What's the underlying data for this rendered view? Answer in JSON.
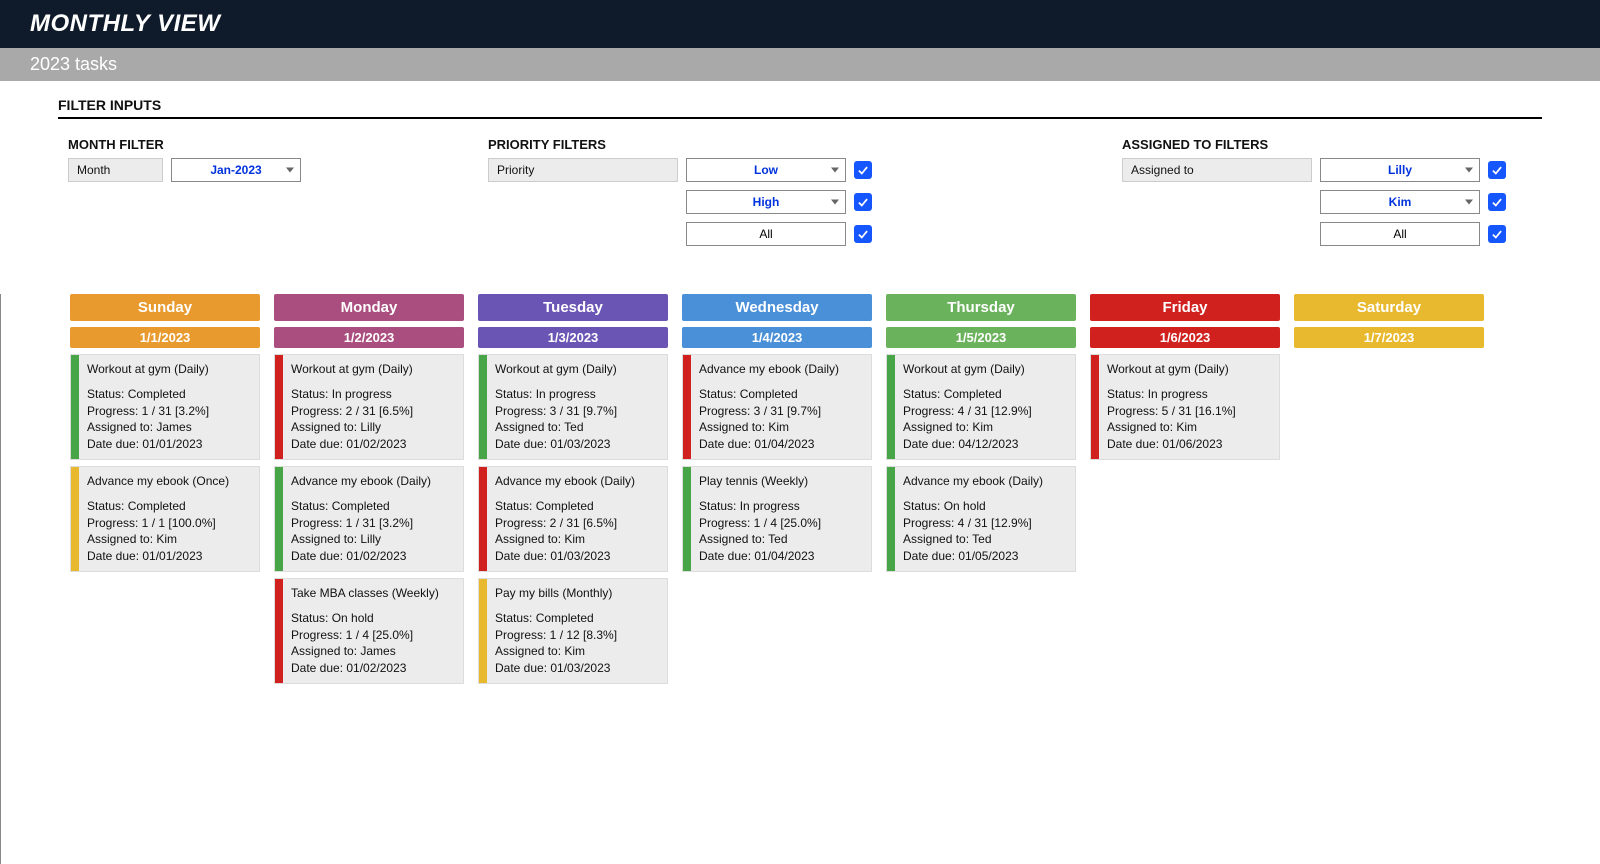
{
  "header": {
    "title": "MONTHLY VIEW",
    "subtitle": "2023 tasks"
  },
  "sections": {
    "filterInputs": "FILTER INPUTS"
  },
  "filters": {
    "month": {
      "heading": "MONTH FILTER",
      "label": "Month",
      "value": "Jan-2023"
    },
    "priority": {
      "heading": "PRIORITY FILTERS",
      "label": "Priority",
      "rows": [
        {
          "value": "Low",
          "checked": true,
          "plain": false
        },
        {
          "value": "High",
          "checked": true,
          "plain": false
        },
        {
          "value": "All",
          "checked": true,
          "plain": true
        }
      ]
    },
    "assigned": {
      "heading": "ASSIGNED TO FILTERS",
      "label": "Assigned to",
      "rows": [
        {
          "value": "Lilly",
          "checked": true,
          "plain": false
        },
        {
          "value": "Kim",
          "checked": true,
          "plain": false
        },
        {
          "value": "All",
          "checked": true,
          "plain": true
        }
      ]
    }
  },
  "calendar": {
    "days": [
      {
        "name": "Sunday",
        "date": "1/1/2023",
        "color": "c-sun",
        "tasks": [
          {
            "bar": "b-green",
            "title": "Workout at gym (Daily)",
            "status": "Completed",
            "progress": "1 / 31  [3.2%]",
            "assigned": "James",
            "due": "01/01/2023"
          },
          {
            "bar": "b-yellow",
            "title": "Advance my ebook (Once)",
            "status": "Completed",
            "progress": "1 / 1  [100.0%]",
            "assigned": "Kim",
            "due": "01/01/2023"
          }
        ]
      },
      {
        "name": "Monday",
        "date": "1/2/2023",
        "color": "c-mon",
        "tasks": [
          {
            "bar": "b-red",
            "title": "Workout at gym (Daily)",
            "status": "In progress",
            "progress": "2 / 31  [6.5%]",
            "assigned": "Lilly",
            "due": "01/02/2023"
          },
          {
            "bar": "b-green",
            "title": "Advance my ebook (Daily)",
            "status": "Completed",
            "progress": "1 / 31  [3.2%]",
            "assigned": "Lilly",
            "due": "01/02/2023"
          },
          {
            "bar": "b-red",
            "title": "Take MBA classes (Weekly)",
            "status": "On hold",
            "progress": "1 / 4  [25.0%]",
            "assigned": "James",
            "due": "01/02/2023"
          }
        ]
      },
      {
        "name": "Tuesday",
        "date": "1/3/2023",
        "color": "c-tue",
        "tasks": [
          {
            "bar": "b-green",
            "title": "Workout at gym (Daily)",
            "status": "In progress",
            "progress": "3 / 31  [9.7%]",
            "assigned": "Ted",
            "due": "01/03/2023"
          },
          {
            "bar": "b-red",
            "title": "Advance my ebook (Daily)",
            "status": "Completed",
            "progress": "2 / 31  [6.5%]",
            "assigned": "Kim",
            "due": "01/03/2023"
          },
          {
            "bar": "b-yellow",
            "title": "Pay my bills (Monthly)",
            "status": "Completed",
            "progress": "1 / 12  [8.3%]",
            "assigned": "Kim",
            "due": "01/03/2023"
          }
        ]
      },
      {
        "name": "Wednesday",
        "date": "1/4/2023",
        "color": "c-wed",
        "tasks": [
          {
            "bar": "b-red",
            "title": "Advance my ebook (Daily)",
            "status": "Completed",
            "progress": "3 / 31  [9.7%]",
            "assigned": "Kim",
            "due": "01/04/2023"
          },
          {
            "bar": "b-green",
            "title": "Play tennis (Weekly)",
            "status": "In progress",
            "progress": "1 / 4  [25.0%]",
            "assigned": "Ted",
            "due": "01/04/2023"
          }
        ]
      },
      {
        "name": "Thursday",
        "date": "1/5/2023",
        "color": "c-thu",
        "tasks": [
          {
            "bar": "b-green",
            "title": "Workout at gym (Daily)",
            "status": "Completed",
            "progress": "4 / 31  [12.9%]",
            "assigned": "Kim",
            "due": "04/12/2023"
          },
          {
            "bar": "b-green",
            "title": "Advance my ebook (Daily)",
            "status": "On hold",
            "progress": "4 / 31  [12.9%]",
            "assigned": "Ted",
            "due": "01/05/2023"
          }
        ]
      },
      {
        "name": "Friday",
        "date": "1/6/2023",
        "color": "c-fri",
        "tasks": [
          {
            "bar": "b-red",
            "title": "Workout at gym (Daily)",
            "status": "In progress",
            "progress": "5 / 31  [16.1%]",
            "assigned": "Kim",
            "due": "01/06/2023"
          }
        ]
      },
      {
        "name": "Saturday",
        "date": "1/7/2023",
        "color": "c-sat",
        "tasks": []
      }
    ]
  },
  "labels": {
    "status": "Status: ",
    "progress": "Progress: ",
    "assigned": "Assigned to: ",
    "due": "Date due: "
  }
}
